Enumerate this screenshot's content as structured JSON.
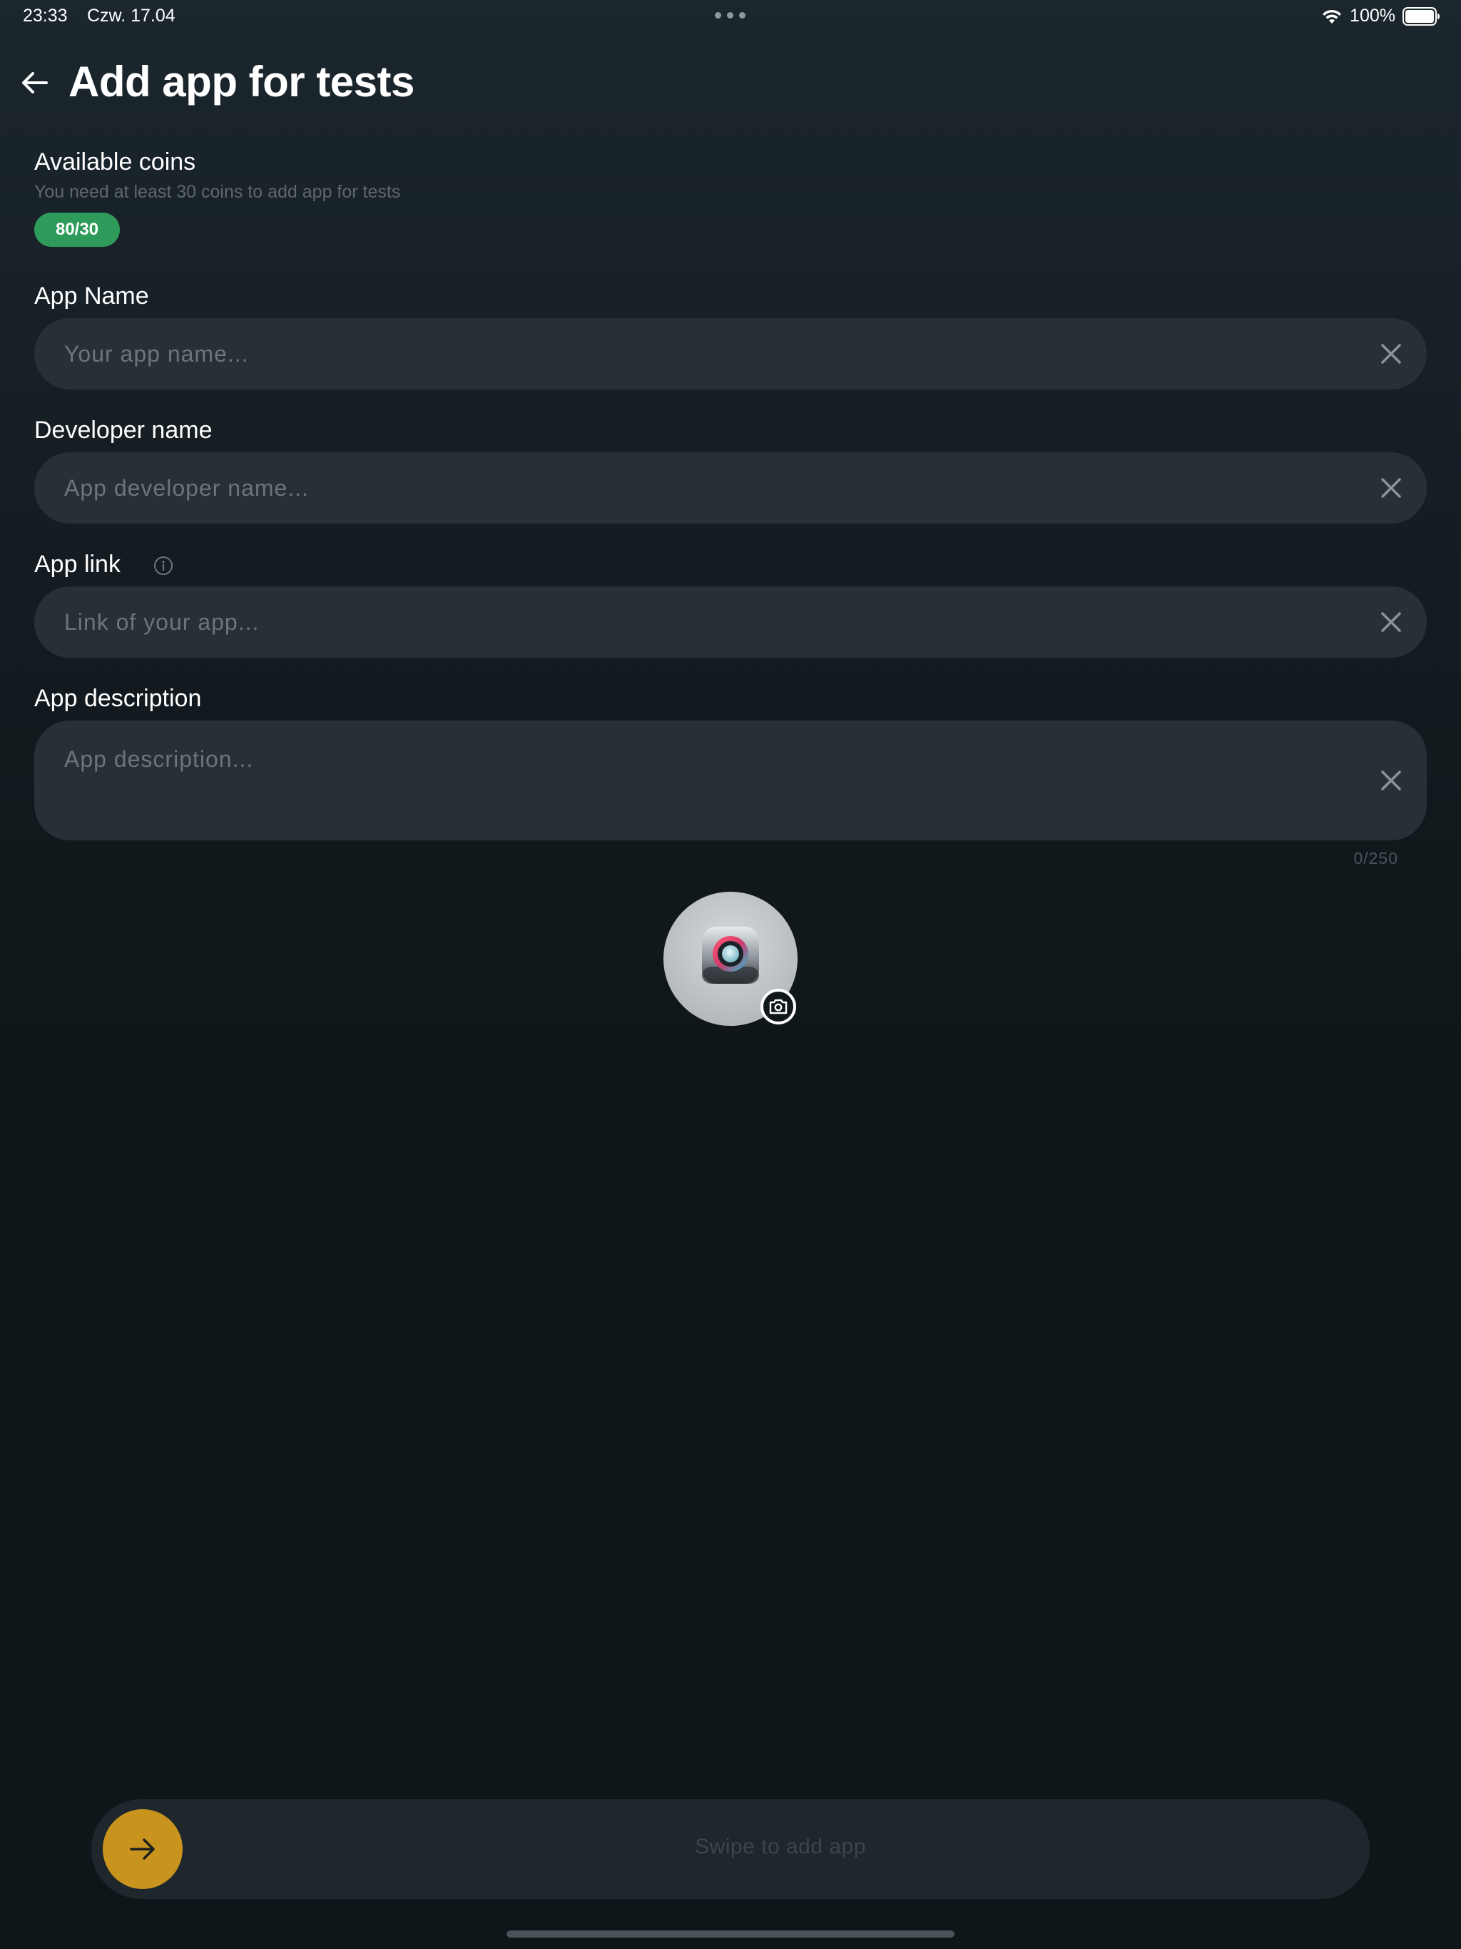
{
  "status_bar": {
    "time": "23:33",
    "date": "Czw. 17.04",
    "battery": "100%"
  },
  "header": {
    "title": "Add app for tests",
    "back_icon": "arrow-left-icon"
  },
  "coins": {
    "title": "Available coins",
    "hint": "You need at least 30 coins to add app for tests",
    "badge": "80/30",
    "badge_color": "#2e9b5a"
  },
  "form": {
    "app_name": {
      "label": "App Name",
      "placeholder": "Your app name...",
      "value": ""
    },
    "developer_name": {
      "label": "Developer name",
      "placeholder": "App developer name...",
      "value": ""
    },
    "app_link": {
      "label": "App link",
      "placeholder": "Link of your app...",
      "value": "",
      "info_icon": "info-icon"
    },
    "app_description": {
      "label": "App description",
      "placeholder": "App description...",
      "value": "",
      "counter": "0/250"
    }
  },
  "icon_picker": {
    "camera_icon": "camera-icon"
  },
  "swipe": {
    "label": "Swipe to add app",
    "knob_icon": "arrow-right-icon",
    "knob_color": "#c8941e"
  }
}
